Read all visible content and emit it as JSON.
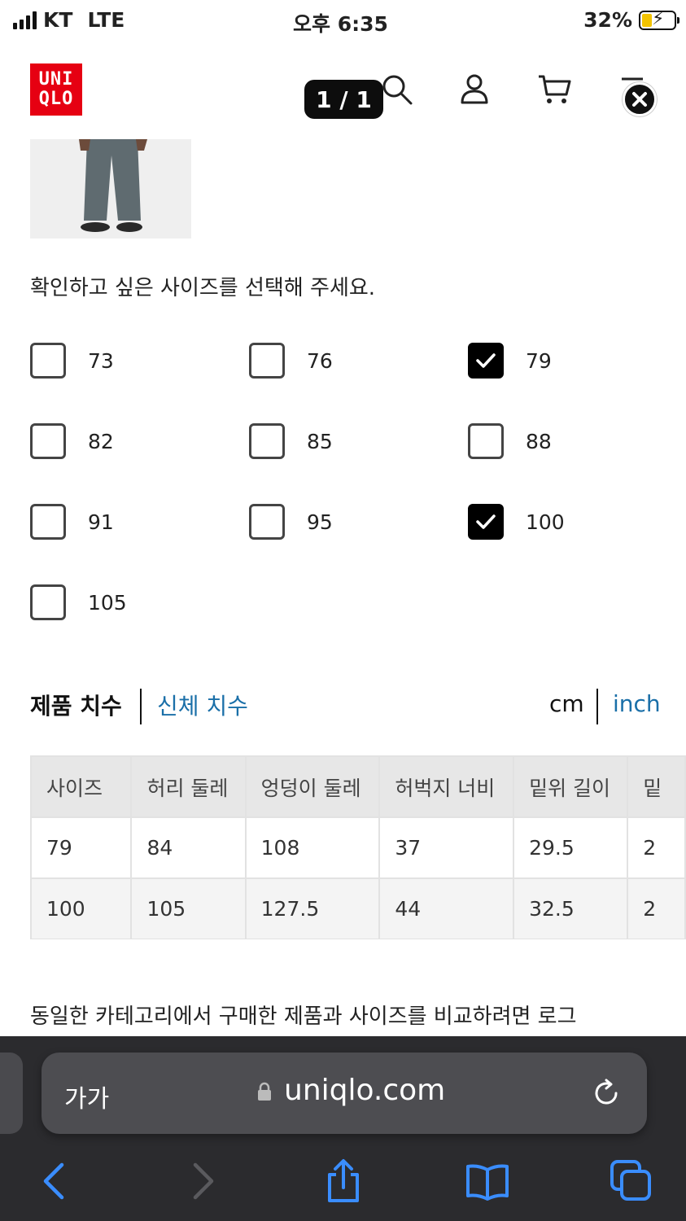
{
  "status_bar": {
    "carrier": "KT",
    "network": "LTE",
    "time": "오후 6:35",
    "battery": "32%"
  },
  "header": {
    "logo_line1": "UNI",
    "logo_line2": "QLO",
    "pager": "1 / 1"
  },
  "size_select": {
    "prompt": "확인하고 싶은 사이즈를 선택해 주세요.",
    "options": [
      {
        "label": "73",
        "checked": false
      },
      {
        "label": "76",
        "checked": false
      },
      {
        "label": "79",
        "checked": true
      },
      {
        "label": "82",
        "checked": false
      },
      {
        "label": "85",
        "checked": false
      },
      {
        "label": "88",
        "checked": false
      },
      {
        "label": "91",
        "checked": false
      },
      {
        "label": "95",
        "checked": false
      },
      {
        "label": "100",
        "checked": true
      },
      {
        "label": "105",
        "checked": false
      }
    ]
  },
  "tabs": {
    "product_size": "제품 치수",
    "body_size": "신체 치수",
    "unit_cm": "cm",
    "unit_inch": "inch"
  },
  "size_table": {
    "headers": [
      "사이즈",
      "허리 둘레",
      "엉덩이 둘레",
      "허벅지 너비",
      "밑위 길이",
      "밑"
    ],
    "rows": [
      [
        "79",
        "84",
        "108",
        "37",
        "29.5",
        "2"
      ],
      [
        "100",
        "105",
        "127.5",
        "44",
        "32.5",
        "2"
      ]
    ]
  },
  "note": "동일한 카테고리에서 구매한 제품과 사이즈를 비교하려면 로그",
  "browser": {
    "text_size": "가가",
    "domain": "uniqlo.com"
  },
  "colors": {
    "brand_red": "#e60012",
    "link_blue": "#1a6fa8",
    "browser_bg": "#2b2b2e",
    "toolbar_blue": "#3a8dff"
  }
}
